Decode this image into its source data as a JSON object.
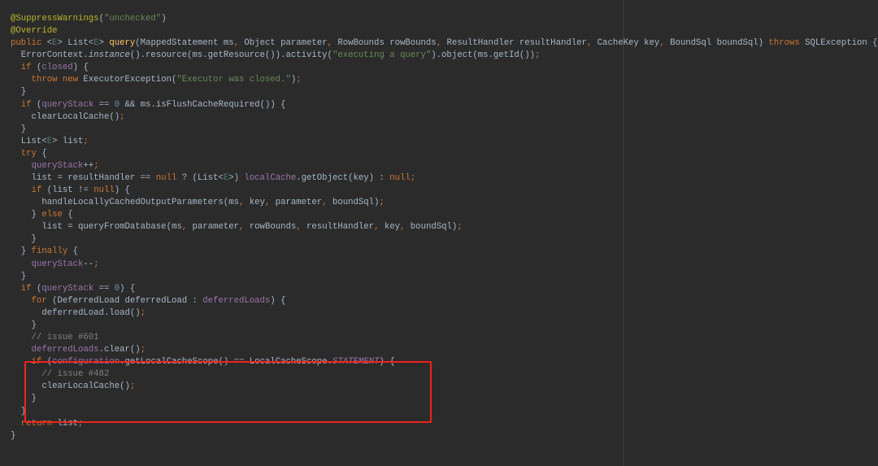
{
  "colors": {
    "background": "#2b2b2b",
    "keyword": "#cc7832",
    "string": "#6a8759",
    "field": "#9876aa",
    "method": "#ffc66d",
    "comment": "#808080",
    "number": "#6897bb",
    "annotation": "#bbb529",
    "highlight_box": "#f0231f"
  },
  "code": {
    "lines": [
      [
        [
          "@SuppressWarnings",
          "ann"
        ],
        [
          "(",
          "pl"
        ],
        [
          "\"unchecked\"",
          "str"
        ],
        [
          ")",
          "pl"
        ]
      ],
      [
        [
          "@Override",
          "ann"
        ]
      ],
      [
        [
          "public ",
          "kw"
        ],
        [
          "<",
          "pl"
        ],
        [
          "E",
          "gen"
        ],
        [
          "> List<",
          "pl"
        ],
        [
          "E",
          "gen"
        ],
        [
          "> ",
          "pl"
        ],
        [
          "query",
          "fn"
        ],
        [
          "(MappedStatement ms",
          "pl"
        ],
        [
          ", ",
          "kw"
        ],
        [
          "Object parameter",
          "pl"
        ],
        [
          ", ",
          "kw"
        ],
        [
          "RowBounds rowBounds",
          "pl"
        ],
        [
          ", ",
          "kw"
        ],
        [
          "ResultHandler resultHandler",
          "pl"
        ],
        [
          ", ",
          "kw"
        ],
        [
          "CacheKey key",
          "pl"
        ],
        [
          ", ",
          "kw"
        ],
        [
          "BoundSql boundSql) ",
          "pl"
        ],
        [
          "throws ",
          "kw"
        ],
        [
          "SQLException {",
          "pl"
        ]
      ],
      [
        [
          "  ErrorContext.",
          "pl"
        ],
        [
          "instance",
          "it"
        ],
        [
          "().resource(ms.getResource()).activity(",
          "pl"
        ],
        [
          "\"executing a query\"",
          "str"
        ],
        [
          ").object(ms.getId())",
          "pl"
        ],
        [
          ";",
          "kw"
        ]
      ],
      [
        [
          "  ",
          "pl"
        ],
        [
          "if ",
          "kw"
        ],
        [
          "(",
          "pl"
        ],
        [
          "closed",
          "fld"
        ],
        [
          ") {",
          "pl"
        ]
      ],
      [
        [
          "    ",
          "pl"
        ],
        [
          "throw new ",
          "kw"
        ],
        [
          "ExecutorException(",
          "pl"
        ],
        [
          "\"Executor was closed.\"",
          "str"
        ],
        [
          ")",
          "pl"
        ],
        [
          ";",
          "kw"
        ]
      ],
      [
        [
          "  }",
          "pl"
        ]
      ],
      [
        [
          "  ",
          "pl"
        ],
        [
          "if ",
          "kw"
        ],
        [
          "(",
          "pl"
        ],
        [
          "queryStack ",
          "fld"
        ],
        [
          "== ",
          "pl"
        ],
        [
          "0 ",
          "num"
        ],
        [
          "&& ms.isFlushCacheRequired()) {",
          "pl"
        ]
      ],
      [
        [
          "    clearLocalCache()",
          "pl"
        ],
        [
          ";",
          "kw"
        ]
      ],
      [
        [
          "  }",
          "pl"
        ]
      ],
      [
        [
          "  List<",
          "pl"
        ],
        [
          "E",
          "gen"
        ],
        [
          "> list",
          "pl"
        ],
        [
          ";",
          "kw"
        ]
      ],
      [
        [
          "  ",
          "pl"
        ],
        [
          "try ",
          "kw"
        ],
        [
          "{",
          "pl"
        ]
      ],
      [
        [
          "    ",
          "pl"
        ],
        [
          "queryStack",
          "fld"
        ],
        [
          "++",
          "pl"
        ],
        [
          ";",
          "kw"
        ]
      ],
      [
        [
          "    list = resultHandler == ",
          "pl"
        ],
        [
          "null ",
          "kw"
        ],
        [
          "? (List<",
          "pl"
        ],
        [
          "E",
          "gen"
        ],
        [
          ">) ",
          "pl"
        ],
        [
          "localCache",
          "fld"
        ],
        [
          ".getObject(key) : ",
          "pl"
        ],
        [
          "null",
          "kw"
        ],
        [
          ";",
          "kw"
        ]
      ],
      [
        [
          "    ",
          "pl"
        ],
        [
          "if ",
          "kw"
        ],
        [
          "(list != ",
          "pl"
        ],
        [
          "null",
          "kw"
        ],
        [
          ") {",
          "pl"
        ]
      ],
      [
        [
          "      handleLocallyCachedOutputParameters(ms",
          "pl"
        ],
        [
          ", ",
          "kw"
        ],
        [
          "key",
          "pl"
        ],
        [
          ", ",
          "kw"
        ],
        [
          "parameter",
          "pl"
        ],
        [
          ", ",
          "kw"
        ],
        [
          "boundSql)",
          "pl"
        ],
        [
          ";",
          "kw"
        ]
      ],
      [
        [
          "    } ",
          "pl"
        ],
        [
          "else ",
          "kw"
        ],
        [
          "{",
          "pl"
        ]
      ],
      [
        [
          "      list = queryFromDatabase(ms",
          "pl"
        ],
        [
          ", ",
          "kw"
        ],
        [
          "parameter",
          "pl"
        ],
        [
          ", ",
          "kw"
        ],
        [
          "rowBounds",
          "pl"
        ],
        [
          ", ",
          "kw"
        ],
        [
          "resultHandler",
          "pl"
        ],
        [
          ", ",
          "kw"
        ],
        [
          "key",
          "pl"
        ],
        [
          ", ",
          "kw"
        ],
        [
          "boundSql)",
          "pl"
        ],
        [
          ";",
          "kw"
        ]
      ],
      [
        [
          "    }",
          "pl"
        ]
      ],
      [
        [
          "  } ",
          "pl"
        ],
        [
          "finally ",
          "kw"
        ],
        [
          "{",
          "pl"
        ]
      ],
      [
        [
          "    ",
          "pl"
        ],
        [
          "queryStack",
          "fld"
        ],
        [
          "--",
          "pl"
        ],
        [
          ";",
          "kw"
        ]
      ],
      [
        [
          "  }",
          "pl"
        ]
      ],
      [
        [
          "  ",
          "pl"
        ],
        [
          "if ",
          "kw"
        ],
        [
          "(",
          "pl"
        ],
        [
          "queryStack ",
          "fld"
        ],
        [
          "== ",
          "pl"
        ],
        [
          "0",
          "num"
        ],
        [
          ") {",
          "pl"
        ]
      ],
      [
        [
          "    ",
          "pl"
        ],
        [
          "for ",
          "kw"
        ],
        [
          "(DeferredLoad deferredLoad : ",
          "pl"
        ],
        [
          "deferredLoads",
          "fld"
        ],
        [
          ") {",
          "pl"
        ]
      ],
      [
        [
          "      deferredLoad.load()",
          "pl"
        ],
        [
          ";",
          "kw"
        ]
      ],
      [
        [
          "    }",
          "pl"
        ]
      ],
      [
        [
          "    // issue #601",
          "cmt"
        ]
      ],
      [
        [
          "    ",
          "pl"
        ],
        [
          "deferredLoads",
          "fld"
        ],
        [
          ".clear()",
          "pl"
        ],
        [
          ";",
          "kw"
        ]
      ],
      [
        [
          "    ",
          "pl"
        ],
        [
          "if ",
          "kw"
        ],
        [
          "(",
          "pl"
        ],
        [
          "configuration",
          "fld"
        ],
        [
          ".getLocalCacheScope() == LocalCacheScope.",
          "pl"
        ],
        [
          "STATEMENT",
          "sfld"
        ],
        [
          ") {",
          "pl"
        ]
      ],
      [
        [
          "      // issue #482",
          "cmt"
        ]
      ],
      [
        [
          "      clearLocalCache()",
          "pl"
        ],
        [
          ";",
          "kw"
        ]
      ],
      [
        [
          "    }",
          "pl"
        ]
      ],
      [
        [
          "  }",
          "pl"
        ]
      ],
      [
        [
          "  ",
          "pl"
        ],
        [
          "return ",
          "kw"
        ],
        [
          "list",
          "pl"
        ],
        [
          ";",
          "kw"
        ]
      ],
      [
        [
          "}",
          "pl"
        ]
      ]
    ]
  }
}
